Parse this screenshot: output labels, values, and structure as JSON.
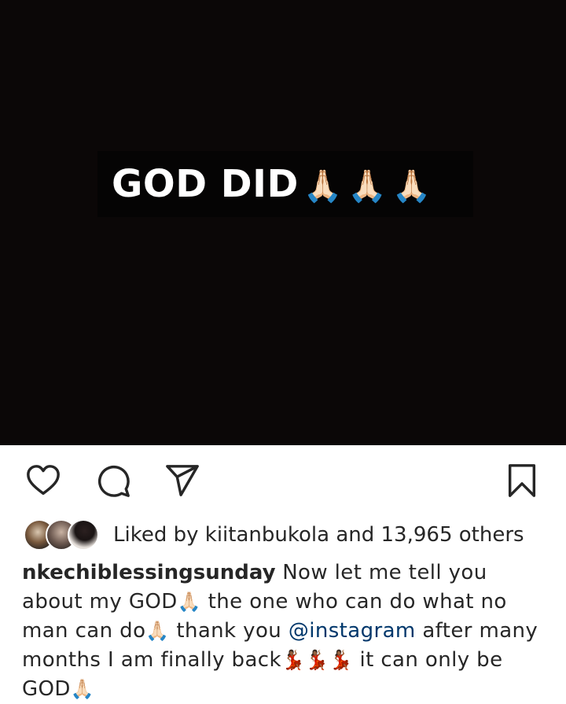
{
  "post": {
    "overlay_text": "GOD DID",
    "overlay_emoji": [
      "🙏🏻",
      "🙏🏻",
      "🙏🏻"
    ]
  },
  "actions": {
    "like_icon": "heart-icon",
    "comment_icon": "comment-icon",
    "share_icon": "share-icon",
    "save_icon": "bookmark-icon"
  },
  "likes": {
    "prefix": "Liked by",
    "user": "kiitanbukola",
    "and": "and",
    "count_text": "13,965 others"
  },
  "caption": {
    "username": "nkechiblessingsunday",
    "text_1": "Now let me tell you about my GOD",
    "emoji_1": "🙏🏻",
    "text_2": "the one who can do what no man can do",
    "emoji_2": "🙏🏻",
    "text_3": "thank you",
    "mention": "@instagram",
    "text_4": "after many months I am finally back",
    "emoji_3": "💃🏾💃🏾💃🏾",
    "text_5": "it can only be GOD",
    "emoji_4": "🙏🏻"
  }
}
